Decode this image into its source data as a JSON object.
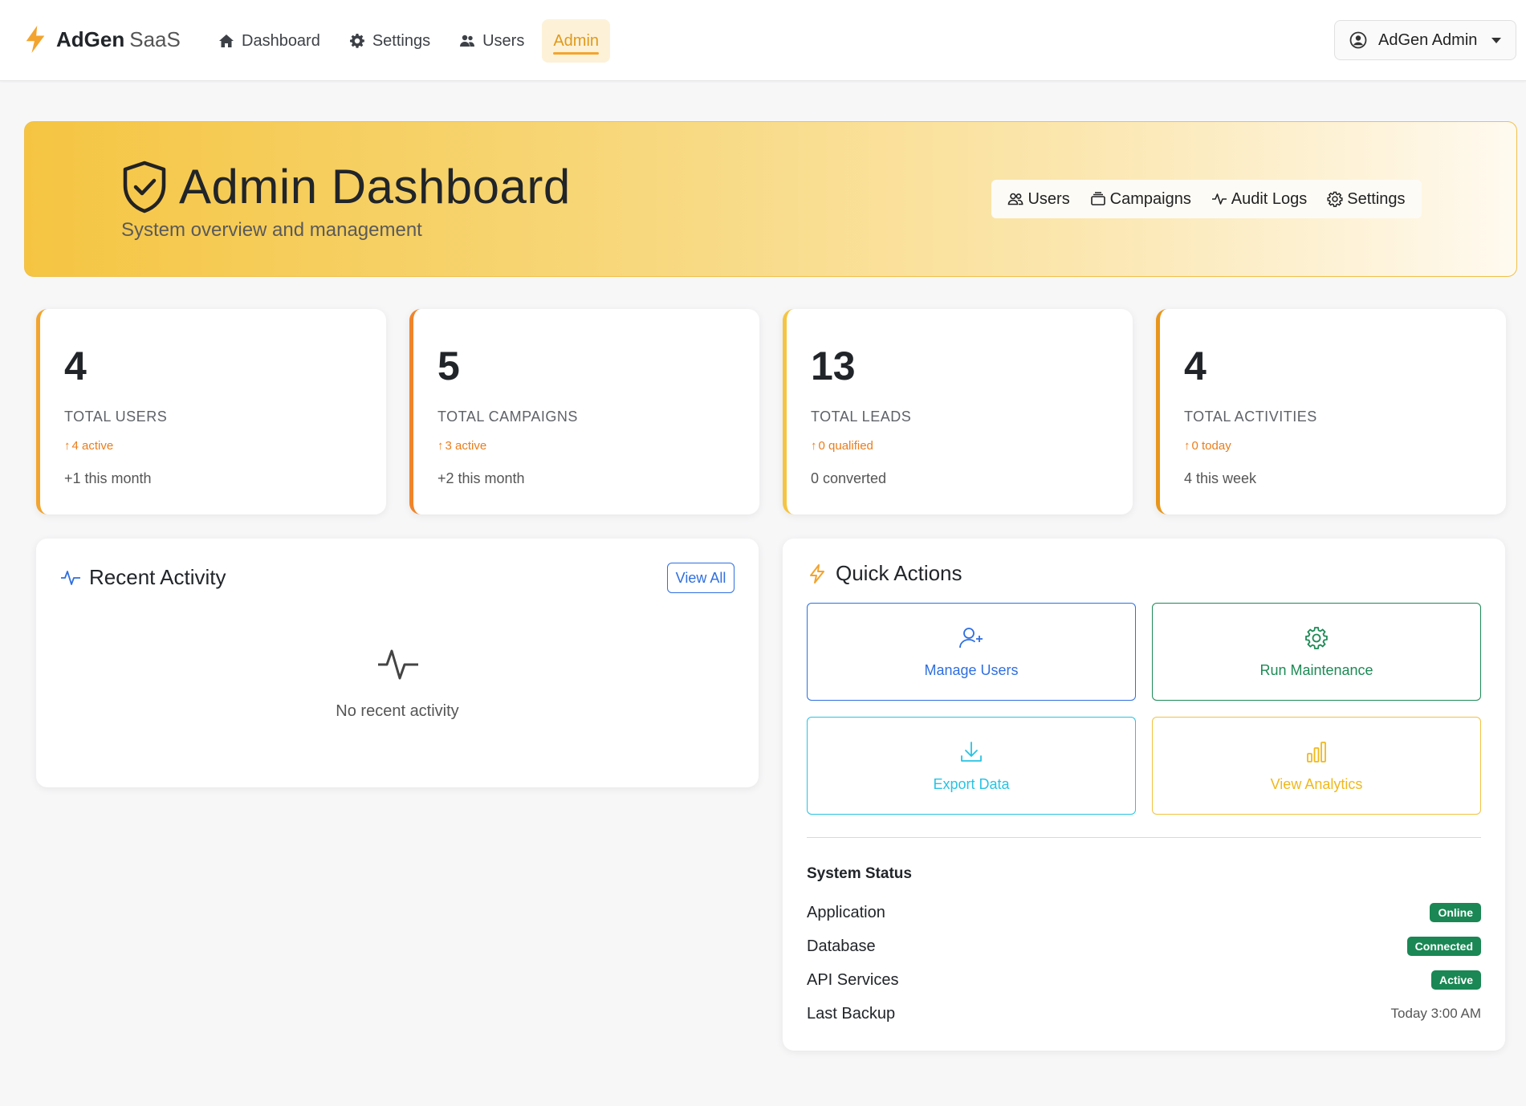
{
  "brand": {
    "name": "AdGen",
    "suffix": "SaaS",
    "icon": "lightning-bolt-icon",
    "color": "#f2a42f"
  },
  "nav": {
    "items": [
      {
        "label": "Dashboard",
        "icon": "home-icon",
        "active": false
      },
      {
        "label": "Settings",
        "icon": "gear-icon",
        "active": false
      },
      {
        "label": "Users",
        "icon": "users-icon",
        "active": false
      },
      {
        "label": "Admin",
        "icon": "",
        "active": true
      }
    ]
  },
  "user_menu": {
    "label": "AdGen Admin",
    "icon": "user-circle-icon"
  },
  "hero": {
    "title": "Admin Dashboard",
    "subtitle": "System overview and management",
    "icon": "shield-check-icon",
    "links": [
      {
        "label": "Users",
        "icon": "people-icon"
      },
      {
        "label": "Campaigns",
        "icon": "collection-icon"
      },
      {
        "label": "Audit Logs",
        "icon": "activity-icon"
      },
      {
        "label": "Settings",
        "icon": "gear-outline-icon"
      }
    ]
  },
  "stats": [
    {
      "value": "4",
      "label": "TOTAL USERS",
      "trend": "4 active",
      "note": "+1 this month",
      "accent": "#f2a42f"
    },
    {
      "value": "5",
      "label": "TOTAL CAMPAIGNS",
      "trend": "3 active",
      "note": "+2 this month",
      "accent": "#f0842a"
    },
    {
      "value": "13",
      "label": "TOTAL LEADS",
      "trend": "0 qualified",
      "note": "0 converted",
      "accent": "#f5c542"
    },
    {
      "value": "4",
      "label": "TOTAL ACTIVITIES",
      "trend": "0 today",
      "note": "4 this week",
      "accent": "#e8961b"
    }
  ],
  "recent_activity": {
    "title": "Recent Activity",
    "view_all_label": "View All",
    "empty_text": "No recent activity"
  },
  "quick_actions": {
    "title": "Quick Actions",
    "actions": [
      {
        "label": "Manage Users",
        "icon": "person-plus-icon",
        "color": "#2f6fe0"
      },
      {
        "label": "Run Maintenance",
        "icon": "gear-icon",
        "color": "#1d8a55"
      },
      {
        "label": "Export Data",
        "icon": "download-icon",
        "color": "#28c3e2"
      },
      {
        "label": "View Analytics",
        "icon": "bar-chart-icon",
        "color": "#f0b81c"
      }
    ]
  },
  "system_status": {
    "heading": "System Status",
    "rows": [
      {
        "label": "Application",
        "value": "Online",
        "type": "badge"
      },
      {
        "label": "Database",
        "value": "Connected",
        "type": "badge"
      },
      {
        "label": "API Services",
        "value": "Active",
        "type": "badge"
      },
      {
        "label": "Last Backup",
        "value": "Today 3:00 AM",
        "type": "text"
      }
    ]
  }
}
